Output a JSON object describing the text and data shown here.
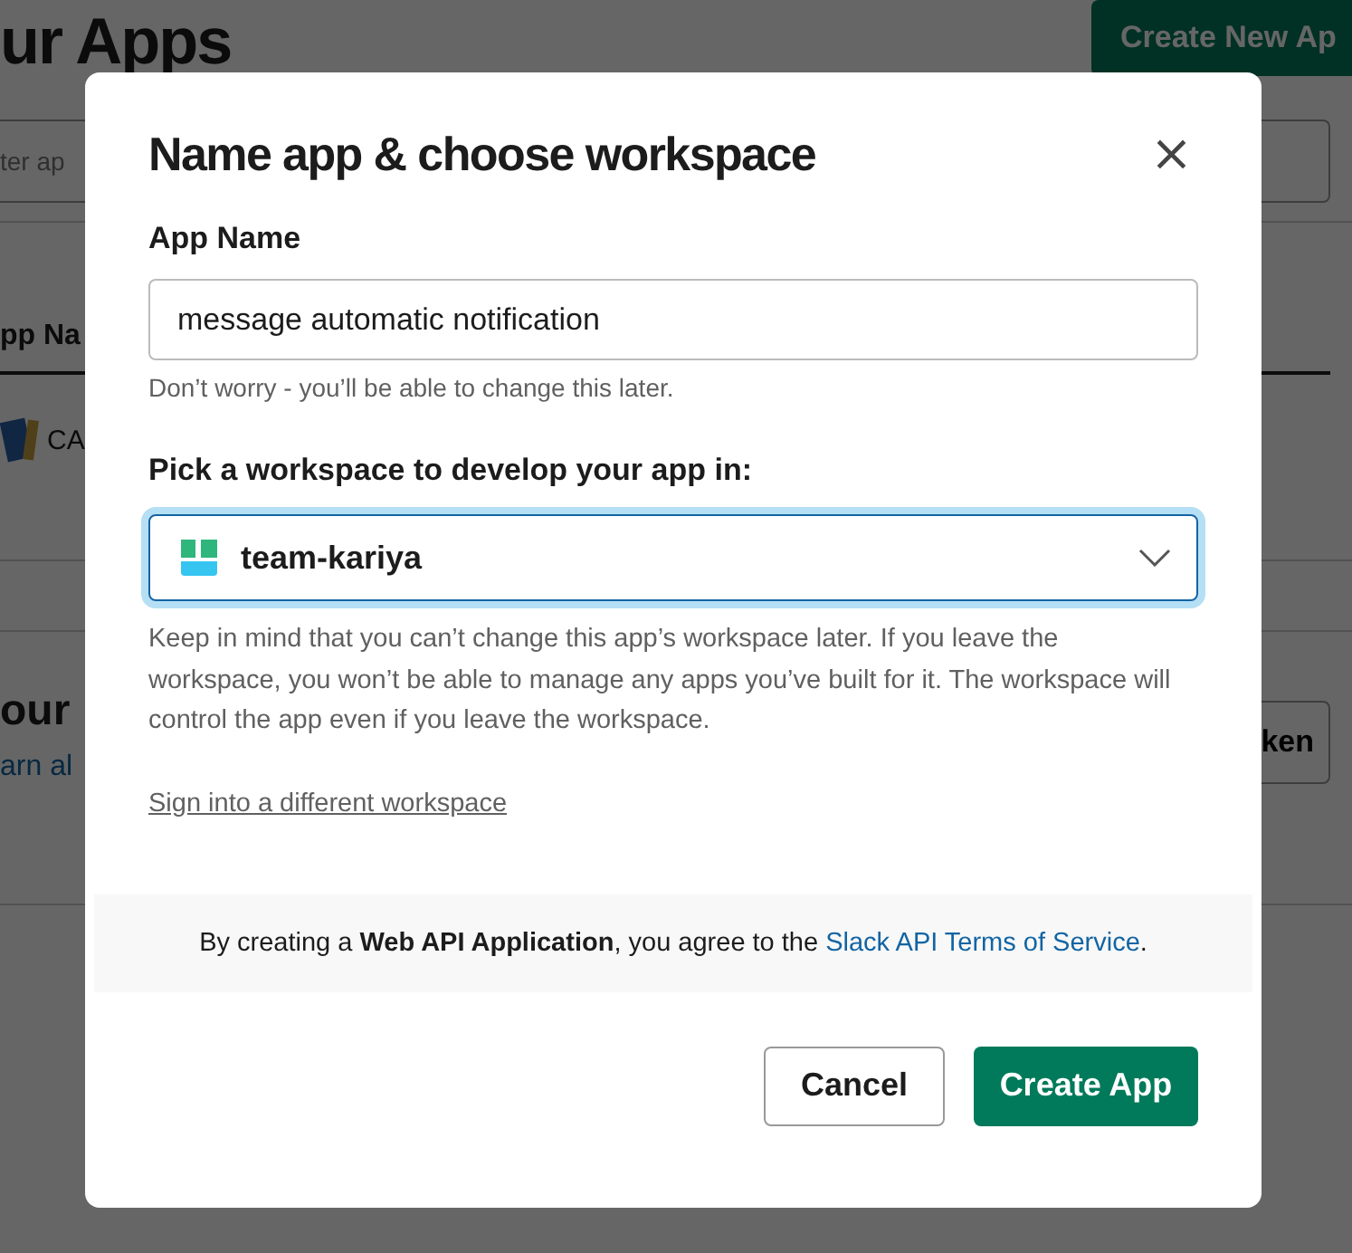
{
  "background": {
    "title": "ur Apps",
    "create_button": "Create New Ap",
    "filter_placeholder": "ter ap",
    "column_header": "pp Na",
    "app_name": "CA",
    "section_title": "our",
    "section_link": "arn al",
    "section_button": "ken"
  },
  "dialog": {
    "title": "Name app & choose workspace",
    "close": "×",
    "app_name_label": "App Name",
    "app_name_value": "message automatic notification",
    "app_name_hint": "Don’t worry - you’ll be able to change this later.",
    "workspace_label": "Pick a workspace to develop your app in:",
    "workspace_value": "team-kariya",
    "workspace_note": "Keep in mind that you can’t change this app’s workspace later. If you leave the workspace, you won’t be able to manage any apps you’ve built for it. The workspace will control the app even if you leave the workspace.",
    "sign_in_link": "Sign into a different workspace",
    "footer": {
      "before": "By creating a **Web API Application**, you agree to the ",
      "link": "Slack API Terms of Service",
      "after": "."
    },
    "buttons": {
      "cancel": "Cancel",
      "create": "Create App"
    }
  }
}
